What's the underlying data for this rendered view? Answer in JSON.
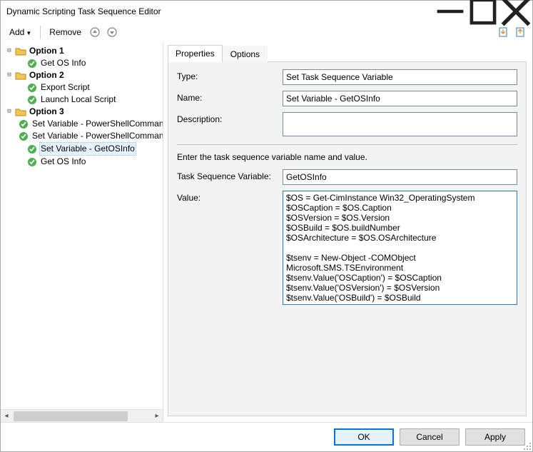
{
  "window": {
    "title": "Dynamic Scripting Task Sequence Editor"
  },
  "toolbar": {
    "add": "Add",
    "remove": "Remove"
  },
  "tree": {
    "option1": {
      "label": "Option 1",
      "items": [
        "Get OS Info"
      ]
    },
    "option2": {
      "label": "Option 2",
      "items": [
        "Export Script",
        "Launch Local Script"
      ]
    },
    "option3": {
      "label": "Option 3",
      "items": [
        "Set Variable - PowerShellCommand",
        "Set Variable - PowerShellCommand",
        "Set Variable - GetOSInfo",
        "Get OS Info"
      ],
      "selectedIndex": 2
    }
  },
  "tabs": {
    "properties": "Properties",
    "options": "Options"
  },
  "form": {
    "typeLabel": "Type:",
    "typeValue": "Set Task Sequence Variable",
    "nameLabel": "Name:",
    "nameValue": "Set Variable - GetOSInfo",
    "descLabel": "Description:",
    "descValue": "",
    "hint": "Enter the task sequence variable name and value.",
    "tsvarLabel": "Task Sequence Variable:",
    "tsvarValue": "GetOSInfo",
    "valueLabel": "Value:",
    "valueValue": "$OS = Get-CimInstance Win32_OperatingSystem\n$OSCaption = $OS.Caption\n$OSVersion = $OS.Version\n$OSBuild = $OS.buildNumber\n$OSArchitecture = $OS.OSArchitecture\n\n$tsenv = New-Object -COMObject Microsoft.SMS.TSEnvironment\n$tsenv.Value('OSCaption') = $OSCaption\n$tsenv.Value('OSVersion') = $OSVersion\n$tsenv.Value('OSBuild') = $OSBuild\n$tsenv.Value('OSArchitecture') = $OSArchitecture\n\nWrite-Host Getting TS Variables"
  },
  "buttons": {
    "ok": "OK",
    "cancel": "Cancel",
    "apply": "Apply"
  }
}
